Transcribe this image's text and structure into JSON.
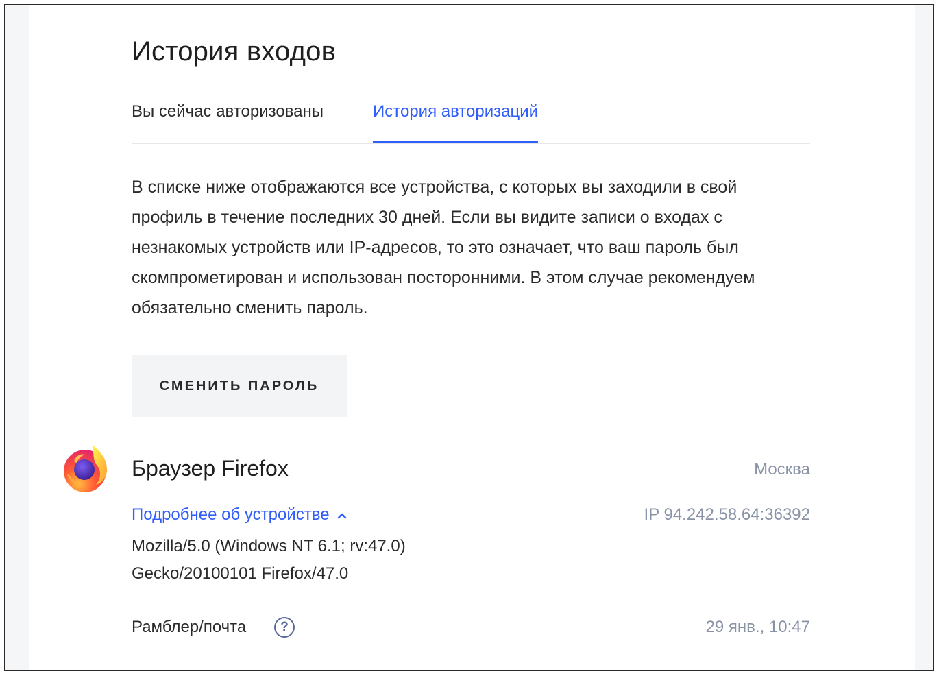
{
  "page": {
    "title": "История входов"
  },
  "tabs": [
    {
      "label": "Вы сейчас авторизованы",
      "active": false
    },
    {
      "label": "История авторизаций",
      "active": true
    }
  ],
  "description": "В списке ниже отображаются все устройства, с которых вы заходили в свой профиль в течение последних 30 дней. Если вы видите записи о входах с незнакомых устройств или IP-адресов, то это означает, что ваш пароль был скомпрометирован и использован посторонними. В этом случае рекомендуем обязательно сменить пароль.",
  "change_password_button": "СМЕНИТЬ ПАРОЛЬ",
  "session": {
    "icon": "firefox-icon",
    "browser": "Браузер Firefox",
    "city": "Москва",
    "details_link": "Подробнее об устройстве",
    "details_icon": "chevron-up-icon",
    "ip": "IP 94.242.58.64:36392",
    "user_agent_line1": "Mozilla/5.0 (Windows NT 6.1; rv:47.0)",
    "user_agent_line2": "Gecko/20100101 Firefox/47.0",
    "service": "Рамблер/почта",
    "help_icon": "question-icon",
    "help_symbol": "?",
    "time": "29 янв., 10:47"
  },
  "colors": {
    "accent": "#315efb",
    "muted_text": "#8a93a6",
    "button_bg": "#f3f4f5"
  }
}
